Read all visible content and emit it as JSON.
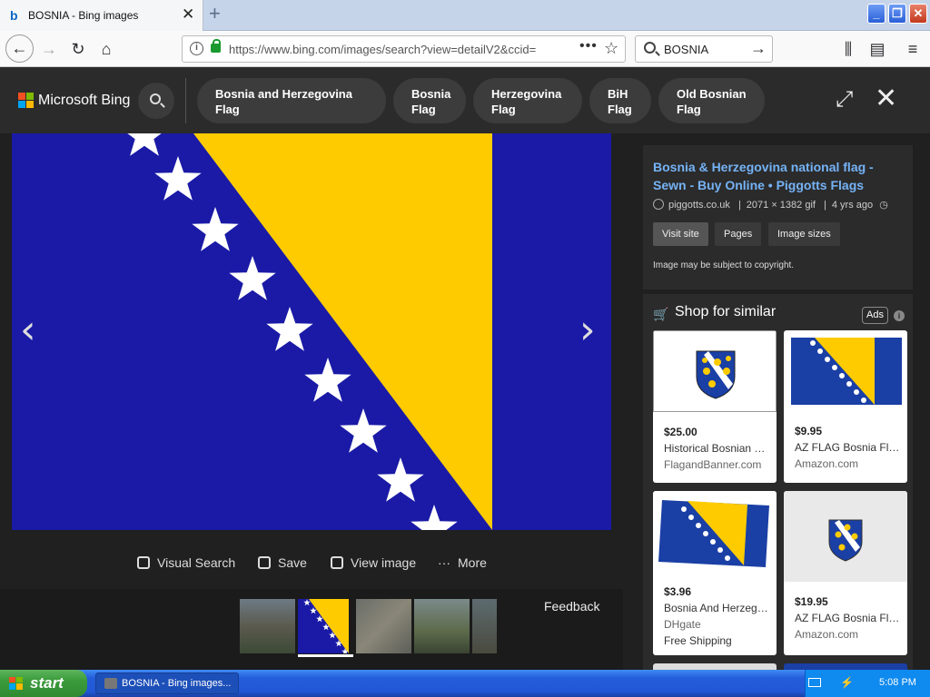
{
  "browser": {
    "tab_title": "BOSNIA - Bing images",
    "tab_close": "✕",
    "new_tab": "+",
    "url": "https://www.bing.com/images/search?view=detailV2&ccid=",
    "url_info": "i",
    "url_dots": "•••",
    "search_value": "BOSNIA",
    "win_min": "_",
    "win_max": "❐",
    "win_close": "✕"
  },
  "bing": {
    "brand": "Microsoft Bing",
    "chips": [
      "Bosnia and Herzegovina Flag",
      "Bosnia Flag",
      "Herzegovina Flag",
      "BiH Flag",
      "Old Bosnian Flag"
    ],
    "colors": {
      "accent_link": "#75b3f6",
      "bg": "#202020",
      "card": "#2b2b2b"
    }
  },
  "viewer": {
    "prev": "‹",
    "next": "›",
    "actions": [
      "Visual Search",
      "Save",
      "View image",
      "More"
    ],
    "feedback": "Feedback"
  },
  "info": {
    "title": "Bosnia & Herzegovina national flag - Sewn - Buy Online • Piggotts Flags",
    "domain": "piggotts.co.uk",
    "dims": "2071 × 1382 gif",
    "age": "4 yrs ago",
    "buttons": [
      "Visit site",
      "Pages",
      "Image sizes"
    ],
    "copyright": "Image may be subject to copyright."
  },
  "shop": {
    "title": "Shop for similar",
    "ads": "Ads",
    "ad_info": "i",
    "products": [
      {
        "price": "$25.00",
        "name": "Historical Bosnian Flag",
        "seller": "FlagandBanner.com"
      },
      {
        "price": "$9.95",
        "name": "AZ FLAG Bosnia Flag",
        "seller": "Amazon.com"
      },
      {
        "price": "$3.96",
        "name": "Bosnia And Herzegovina Flag",
        "seller": "DHgate",
        "shipping": "Free Shipping"
      },
      {
        "price": "$19.95",
        "name": "AZ FLAG Bosnia Flag",
        "seller": "Amazon.com"
      }
    ]
  },
  "taskbar": {
    "start": "start",
    "task": "BOSNIA - Bing images...",
    "clock": "5:08 PM"
  },
  "flag_colors": {
    "blue": "#1a1aa6",
    "yellow": "#fecb00",
    "star": "#ffffff"
  }
}
